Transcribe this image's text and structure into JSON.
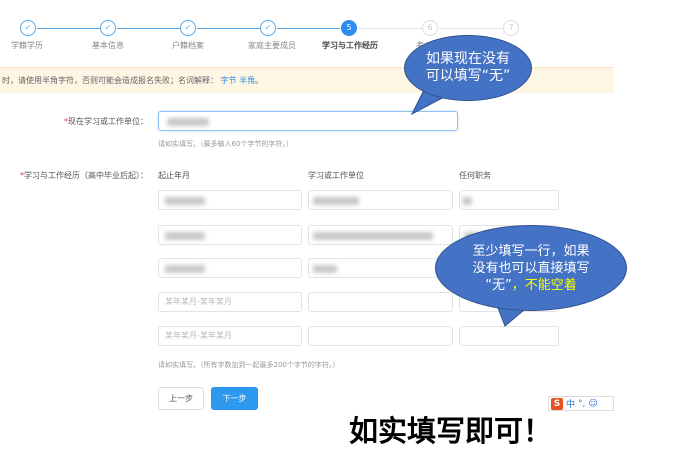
{
  "steps": [
    {
      "label": "学籍学历",
      "marker": "✓",
      "state": "done"
    },
    {
      "label": "基本信息",
      "marker": "✓",
      "state": "done"
    },
    {
      "label": "户籍档案",
      "marker": "✓",
      "state": "done"
    },
    {
      "label": "家庭主要成员",
      "marker": "✓",
      "state": "done"
    },
    {
      "label": "学习与工作经历",
      "marker": "5",
      "state": "current"
    },
    {
      "label": "考",
      "marker": "6",
      "state": "todo"
    },
    {
      "label": "",
      "marker": "7",
      "state": "todo"
    }
  ],
  "notice": {
    "text": "时，请使用半角字符，否则可能会造成报名失败；名词解释：",
    "link1": "字节",
    "link2": "半角",
    "end": "。"
  },
  "current_unit": {
    "label": "现在学习或工作单位：",
    "required": "*",
    "hint": "请如实填写。（最多输入60个字节的字符。）"
  },
  "history": {
    "label": "学习与工作经历（高中毕业后起）：",
    "required": "*",
    "columns": [
      "起止年月",
      "学习或工作单位",
      "任何职务"
    ],
    "placeholder": "某年某月-某年某月",
    "hint": "请如实填写。（所有字数加到一起最多200个字节的字符。）"
  },
  "buttons": {
    "prev": "上一步",
    "next": "下一步"
  },
  "annotations": {
    "bubble1_line1": "如果现在没有",
    "bubble1_line2": "可以填写“无”",
    "bubble2_line1": "至少填写一行，如果",
    "bubble2_line2": "没有也可以直接填写",
    "bubble2_line3a": "“无”",
    "bubble2_line3b": "，不能空着",
    "caption": "如实填写即可！"
  },
  "ime": {
    "logo": "S",
    "mode": "中",
    "punct": "°,",
    "emoji": "☺"
  },
  "colors": {
    "accent": "#2d8cf0",
    "notice_bg": "#fdf6e4",
    "bubble": "#4472c4",
    "highlight": "#ffff00"
  }
}
